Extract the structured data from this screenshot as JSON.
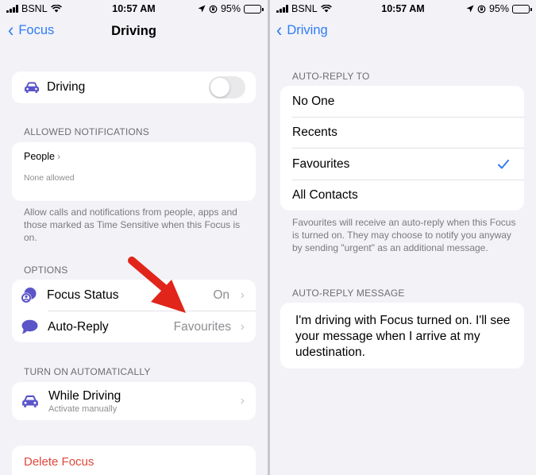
{
  "status_bar": {
    "carrier": "BSNL",
    "time": "10:57 AM",
    "battery": "95%",
    "battery_level": 0.95,
    "battery_color": "#34c759"
  },
  "left_screen": {
    "nav": {
      "back_label": "Focus",
      "title": "Driving"
    },
    "driving_toggle": {
      "label": "Driving",
      "icon": "car-icon",
      "on": false
    },
    "allowed_notifications": {
      "header": "ALLOWED NOTIFICATIONS",
      "people_label": "People",
      "people_value": "None allowed",
      "footnote": "Allow calls and notifications from people, apps and those marked as Time Sensitive when this Focus is on."
    },
    "options": {
      "header": "OPTIONS",
      "items": [
        {
          "label": "Focus Status",
          "value": "On",
          "icon": "focus-status-icon"
        },
        {
          "label": "Auto-Reply",
          "value": "Favourites",
          "icon": "speech-bubble-icon"
        }
      ]
    },
    "turn_on_automatically": {
      "header": "TURN ON AUTOMATICALLY",
      "item_label": "While Driving",
      "item_sublabel": "Activate manually",
      "icon": "car-icon"
    },
    "delete_label": "Delete Focus",
    "annotation": {
      "icon": "red-arrow-icon",
      "color": "#e1251b"
    }
  },
  "right_screen": {
    "nav": {
      "back_label": "Driving"
    },
    "auto_reply_to": {
      "header": "AUTO-REPLY TO",
      "options": [
        {
          "label": "No One",
          "selected": false
        },
        {
          "label": "Recents",
          "selected": false
        },
        {
          "label": "Favourites",
          "selected": true
        },
        {
          "label": "All Contacts",
          "selected": false
        }
      ],
      "footnote": "Favourites will receive an auto-reply when this Focus is turned on. They may choose to notify you anyway by sending \"urgent\" as an additional message."
    },
    "auto_reply_message": {
      "header": "AUTO-REPLY MESSAGE",
      "message": "I'm driving with Focus turned on. I'll see your message when I arrive at my udestination."
    }
  },
  "colors": {
    "accent": "#2f7cf6",
    "icon_purple": "#5a55c9",
    "destructive": "#e0473a",
    "background": "#f2f2f7"
  }
}
